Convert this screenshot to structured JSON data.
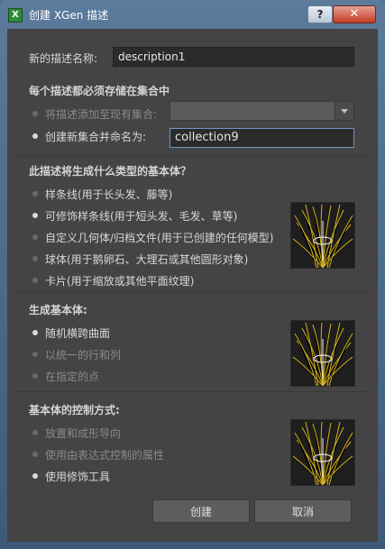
{
  "window": {
    "title": "创建 XGen 描述",
    "app_icon_letter": "X",
    "help_label": "?",
    "close_label": "✕"
  },
  "name_field": {
    "label": "新的描述名称:",
    "value": "description1"
  },
  "collection": {
    "heading": "每个描述都必须存储在集合中",
    "add_existing_label": "将描述添加至现有集合:",
    "create_new_label": "创建新集合并命名为:",
    "new_collection_value": "collection9",
    "existing_selected": ""
  },
  "primitive_type": {
    "heading": "此描述将生成什么类型的基本体？",
    "options": [
      "样条线(用于长头发、藤等)",
      "可修饰样条线(用于短头发、毛发、草等)",
      "自定义几何体/归档文件(用于已创建的任何模型)",
      "球体(用于鹅卵石、大理石或其他圆形对象)",
      "卡片(用于缩放或其他平面纹理)"
    ],
    "selected_index": 1
  },
  "generate": {
    "heading": "生成基本体:",
    "options": [
      "随机横跨曲面",
      "以统一的行和列",
      "在指定的点"
    ],
    "selected_index": 0
  },
  "control": {
    "heading": "基本体的控制方式:",
    "options": [
      "放置和成形导向",
      "使用由表达式控制的属性",
      "使用修饰工具"
    ],
    "selected_index": 2
  },
  "buttons": {
    "create": "创建",
    "cancel": "取消"
  },
  "colors": {
    "panel_bg": "#444444",
    "title_bar": "#5b7a9c",
    "close_red": "#c43b22",
    "focus_border": "#6f96c2",
    "thumbnail_strands": "#d6b21a"
  }
}
